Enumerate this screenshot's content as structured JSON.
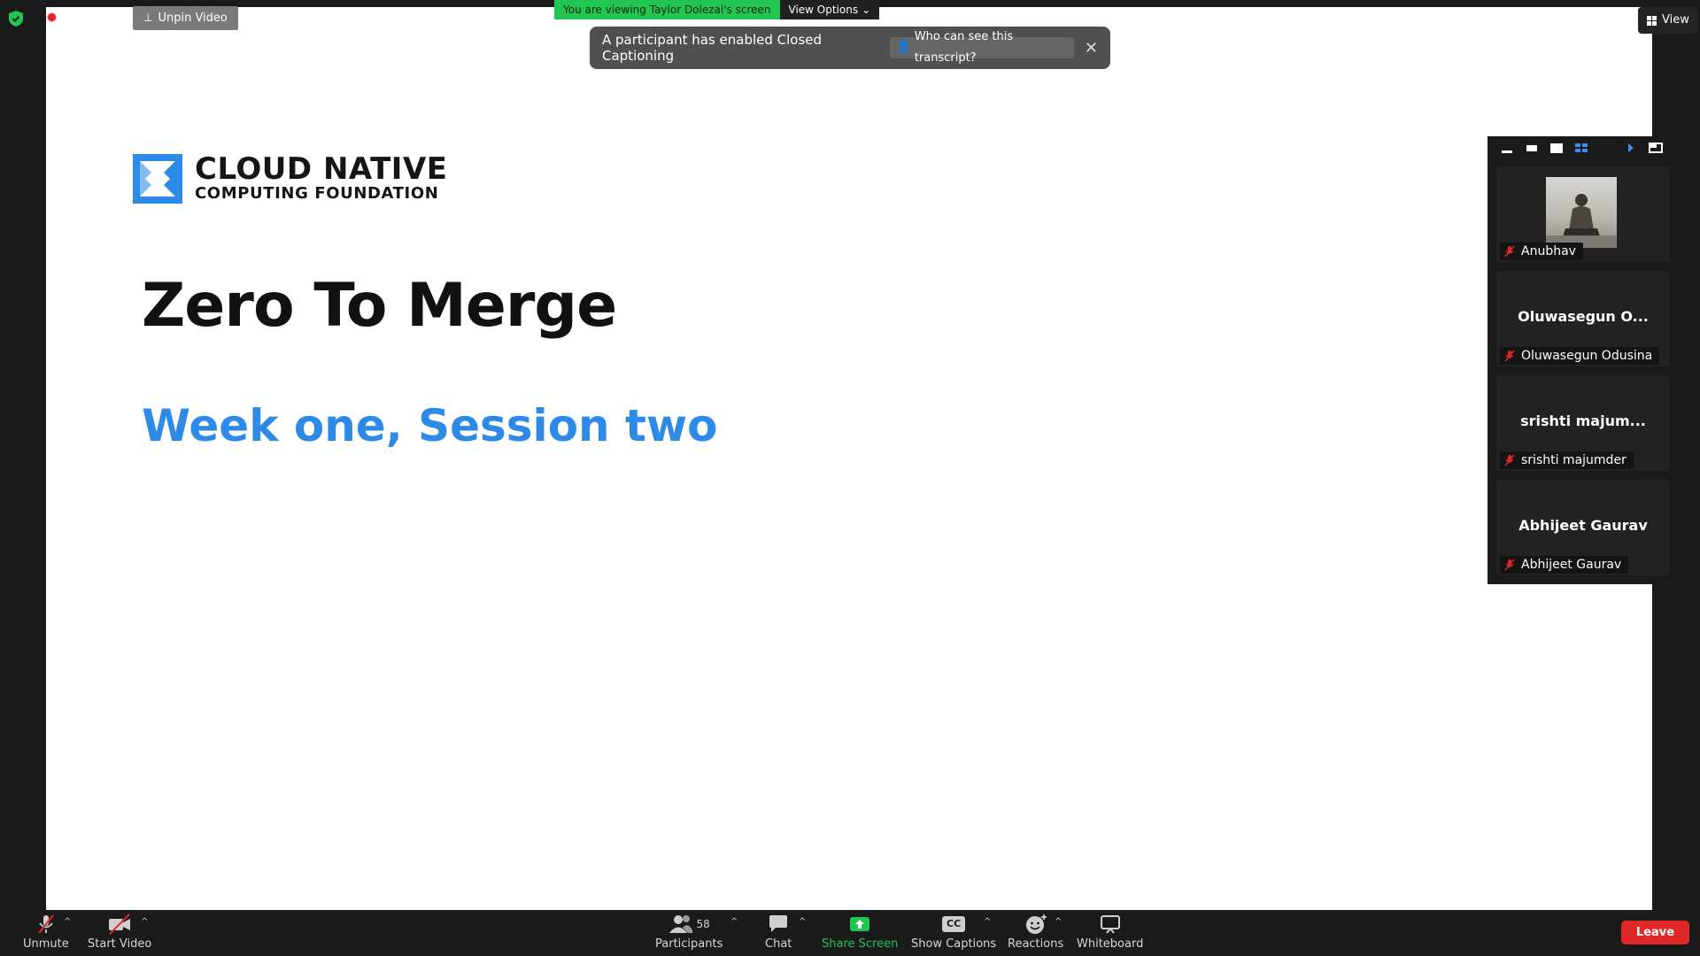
{
  "window": {
    "viewing_banner": "You are viewing Taylor Dolezal's screen",
    "view_options_label": "View Options",
    "view_button_label": "View",
    "unpin_video_label": "Unpin Video"
  },
  "caption_toast": {
    "message": "A participant has enabled Closed Captioning",
    "who_can_see_label": "Who can see this transcript?"
  },
  "slide": {
    "logo_line1": "CLOUD NATIVE",
    "logo_line2": "COMPUTING FOUNDATION",
    "title": "Zero To Merge",
    "subtitle": "Week one, Session two",
    "colors": {
      "subtitle": "#2d8ae6",
      "logo_mark": "#2d8ae6"
    }
  },
  "participants_panel": {
    "tiles": [
      {
        "display_name": "",
        "label": "Anubhav",
        "has_photo": true,
        "muted": true
      },
      {
        "display_name": "Oluwasegun O...",
        "label": "Oluwasegun Odusina",
        "has_photo": false,
        "muted": true
      },
      {
        "display_name": "srishti majum...",
        "label": "srishti majumder",
        "has_photo": false,
        "muted": true
      },
      {
        "display_name": "Abhijeet Gaurav",
        "label": "Abhijeet Gaurav",
        "has_photo": false,
        "muted": true
      }
    ]
  },
  "toolbar": {
    "unmute": "Unmute",
    "start_video": "Start Video",
    "participants": "Participants",
    "participants_count": "58",
    "chat": "Chat",
    "share_screen": "Share Screen",
    "show_captions": "Show Captions",
    "cc_badge": "CC",
    "reactions": "Reactions",
    "whiteboard": "Whiteboard",
    "leave": "Leave",
    "colors": {
      "share": "#23c552",
      "leave": "#e02828"
    }
  }
}
